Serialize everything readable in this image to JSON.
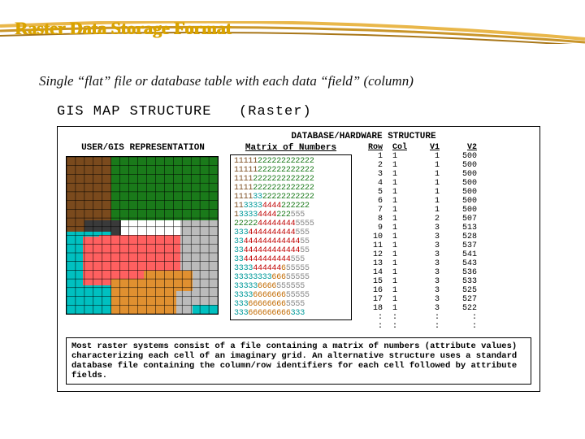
{
  "title": "Raster Data Storage Format",
  "subtitle": "Single “flat” file or database table with each data “field” (column)",
  "figure": {
    "heading_left": "GIS MAP STRUCTURE",
    "heading_right": "(Raster)",
    "db_title": "DATABASE/HARDWARE STRUCTURE",
    "user_rep": "USER/GIS REPRESENTATION",
    "matrix_header": "Matrix of Numbers",
    "table_headers": {
      "row": "Row",
      "col": "Col",
      "v1": "V1",
      "v2": "V2"
    },
    "matrix_rows": [
      [
        [
          "1",
          "11111"
        ],
        [
          "2",
          "222222222222"
        ]
      ],
      [
        [
          "1",
          "11111"
        ],
        [
          "2",
          "222222222222"
        ]
      ],
      [
        [
          "1",
          "1111"
        ],
        [
          "2",
          "2222222222222"
        ]
      ],
      [
        [
          "1",
          "1111"
        ],
        [
          "2",
          "2222222222222"
        ]
      ],
      [
        [
          "1",
          "1111"
        ],
        [
          "3",
          "33"
        ],
        [
          "2",
          "22222222222"
        ]
      ],
      [
        [
          "1",
          "11"
        ],
        [
          "3",
          "3333"
        ],
        [
          "4",
          "4444"
        ],
        [
          "2",
          "222222"
        ]
      ],
      [
        [
          "1",
          "1"
        ],
        [
          "3",
          "3333"
        ],
        [
          "4",
          "4444"
        ],
        [
          "2",
          "222"
        ],
        [
          "5",
          "555"
        ]
      ],
      [
        [
          "2",
          "22222"
        ],
        [
          "4",
          "44444444"
        ],
        [
          "5",
          "5555"
        ]
      ],
      [
        [
          "3",
          "333"
        ],
        [
          "4",
          "4444444444"
        ],
        [
          "5",
          "555"
        ]
      ],
      [
        [
          "3",
          "33"
        ],
        [
          "4",
          "444444444444"
        ],
        [
          "5",
          "55"
        ]
      ],
      [
        [
          "3",
          "33"
        ],
        [
          "4",
          "444444444444"
        ],
        [
          "5",
          "55"
        ]
      ],
      [
        [
          "3",
          "33"
        ],
        [
          "4",
          "4444444444"
        ],
        [
          "5",
          "555"
        ]
      ],
      [
        [
          "3",
          "3333"
        ],
        [
          "4",
          "444444"
        ],
        [
          "6",
          "6"
        ],
        [
          "5",
          "55555"
        ]
      ],
      [
        [
          "3",
          "33333333"
        ],
        [
          "6",
          "666"
        ],
        [
          "5",
          "55555"
        ]
      ],
      [
        [
          "3",
          "33333"
        ],
        [
          "6",
          "6666"
        ],
        [
          "5",
          "555555"
        ]
      ],
      [
        [
          "3",
          "3333"
        ],
        [
          "6",
          "6666666"
        ],
        [
          "5",
          "55555"
        ]
      ],
      [
        [
          "3",
          "333"
        ],
        [
          "6",
          "66666666"
        ],
        [
          "5",
          "5555"
        ]
      ],
      [
        [
          "3",
          "333"
        ],
        [
          "6",
          "666666666"
        ],
        [
          "3",
          "333"
        ]
      ]
    ],
    "table_rows": [
      {
        "row": "1",
        "col": "1",
        "v1": "1",
        "v2": "500"
      },
      {
        "row": "2",
        "col": "1",
        "v1": "1",
        "v2": "500"
      },
      {
        "row": "3",
        "col": "1",
        "v1": "1",
        "v2": "500"
      },
      {
        "row": "4",
        "col": "1",
        "v1": "1",
        "v2": "500"
      },
      {
        "row": "5",
        "col": "1",
        "v1": "1",
        "v2": "500"
      },
      {
        "row": "6",
        "col": "1",
        "v1": "1",
        "v2": "500"
      },
      {
        "row": "7",
        "col": "1",
        "v1": "1",
        "v2": "500"
      },
      {
        "row": "8",
        "col": "1",
        "v1": "2",
        "v2": "507"
      },
      {
        "row": "9",
        "col": "1",
        "v1": "3",
        "v2": "513"
      },
      {
        "row": "10",
        "col": "1",
        "v1": "3",
        "v2": "528"
      },
      {
        "row": "11",
        "col": "1",
        "v1": "3",
        "v2": "537"
      },
      {
        "row": "12",
        "col": "1",
        "v1": "3",
        "v2": "541"
      },
      {
        "row": "13",
        "col": "1",
        "v1": "3",
        "v2": "543"
      },
      {
        "row": "14",
        "col": "1",
        "v1": "3",
        "v2": "536"
      },
      {
        "row": "15",
        "col": "1",
        "v1": "3",
        "v2": "533"
      },
      {
        "row": "16",
        "col": "1",
        "v1": "3",
        "v2": "525"
      },
      {
        "row": "17",
        "col": "1",
        "v1": "3",
        "v2": "527"
      },
      {
        "row": "18",
        "col": "1",
        "v1": "3",
        "v2": "522"
      },
      {
        "row": ":",
        "col": ":",
        "v1": ":",
        "v2": ":"
      },
      {
        "row": ":",
        "col": ":",
        "v1": ":",
        "v2": ":"
      }
    ],
    "caption": "Most raster systems consist of a file containing a matrix of numbers (attribute values) characterizing each cell of an imaginary grid.  An alternative structure uses a standard database file containing the column/row identifiers for each cell followed by attribute fields."
  },
  "colors": {
    "1": "#7a4a1d",
    "2": "#1a7a1a",
    "3": "#009a9a",
    "4": "#c00000",
    "5": "#888",
    "6": "#c26a00"
  }
}
